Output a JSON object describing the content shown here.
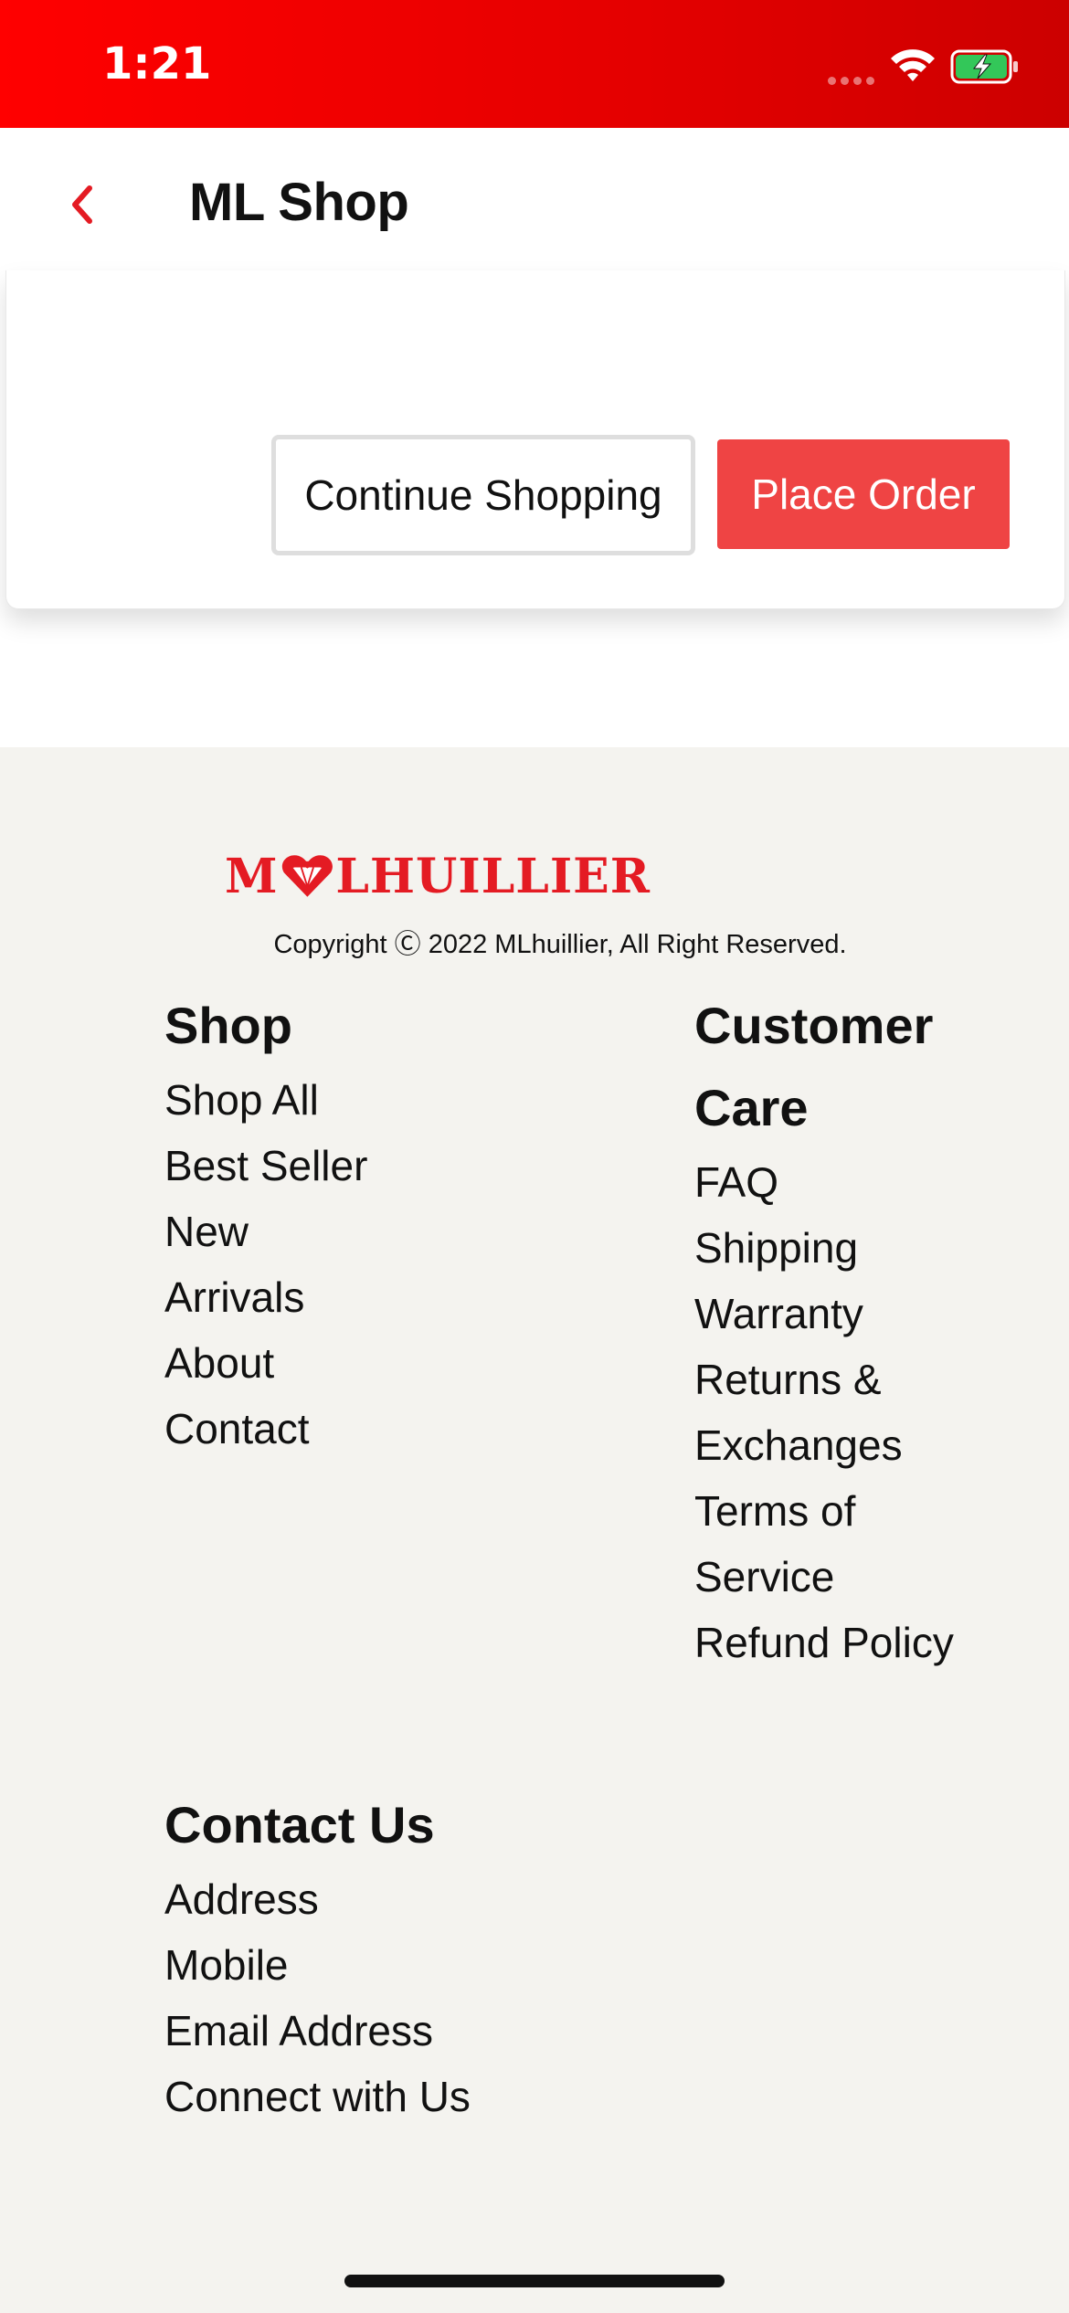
{
  "status_bar": {
    "time": "1:21",
    "background_color": "#e40000",
    "icons": [
      "cellular-signal-icon",
      "wifi-icon",
      "battery-charging-icon"
    ]
  },
  "header": {
    "back_icon": "chevron-left-icon",
    "title": "ML Shop",
    "accent_color": "#e41b23"
  },
  "order_card": {
    "continue_label": "Continue Shopping",
    "place_order_label": "Place Order",
    "place_order_color": "#ef4444"
  },
  "footer": {
    "brand_logo_text": "MLHUILLIER",
    "copyright": "Copyright Ⓒ 2022 MLhuillier, All Right Reserved.",
    "shop": {
      "heading": "Shop",
      "links": [
        "Shop All",
        "Best Seller",
        "New",
        "Arrivals",
        "About",
        "Contact"
      ]
    },
    "customer_care": {
      "heading": "Customer Care",
      "links": [
        "FAQ",
        "Shipping",
        "Warranty",
        "Returns & Exchanges",
        "Terms of Service",
        "Refund Policy"
      ]
    },
    "contact_us": {
      "heading": "Contact Us",
      "links": [
        "Address",
        "Mobile",
        "Email Address",
        "Connect with Us"
      ]
    }
  }
}
